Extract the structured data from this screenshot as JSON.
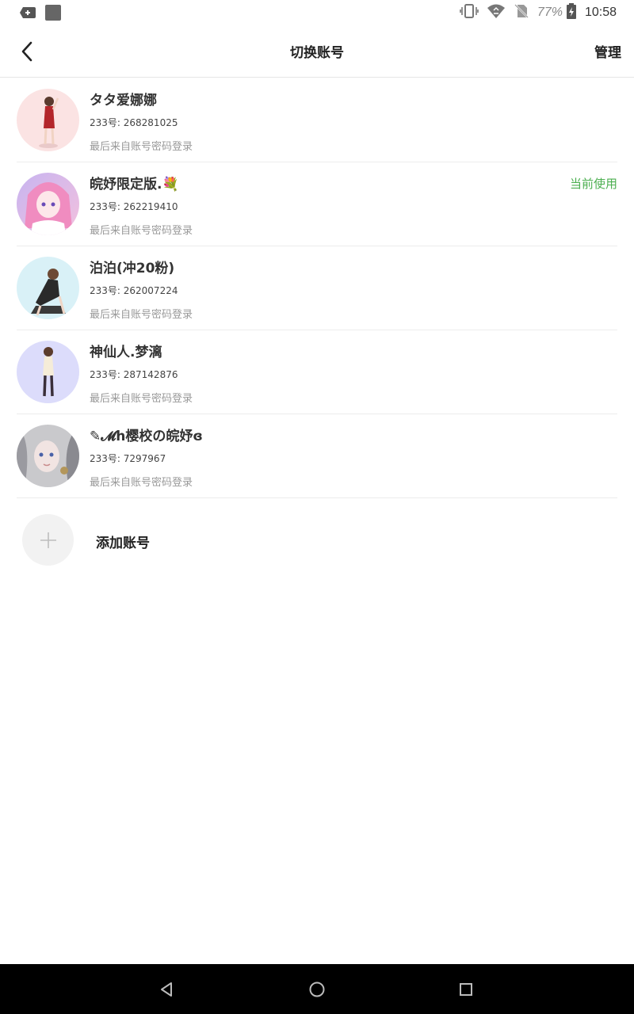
{
  "status_bar": {
    "left_icons": [
      "add-notification-icon",
      "square-app-icon"
    ],
    "right_icons": [
      "vibrate-icon",
      "wifi-icon",
      "no-sim-icon",
      "battery-icon"
    ],
    "battery": "77%",
    "time": "10:58"
  },
  "header": {
    "title": "切换账号",
    "manage_label": "管理",
    "back_icon": "back-arrow-icon"
  },
  "accounts": [
    {
      "nickname": "タタ爱娜娜",
      "uid": "233号: 268281025",
      "login_method": "最后来自账号密码登录",
      "current": "",
      "avatar_bg": "#fbe3e3"
    },
    {
      "nickname": "皖妤限定版.💐",
      "uid": "233号: 262219410",
      "login_method": "最后来自账号密码登录",
      "current": "当前使用",
      "avatar_bg": "#d7c8f2"
    },
    {
      "nickname": "泊泊(冲20粉)",
      "uid": "233号: 262007224",
      "login_method": "最后来自账号密码登录",
      "current": "",
      "avatar_bg": "#d9f1f7"
    },
    {
      "nickname": "神仙人.梦漓",
      "uid": "233号: 287142876",
      "login_method": "最后来自账号密码登录",
      "current": "",
      "avatar_bg": "#dcdcfb"
    },
    {
      "nickname": "✎𝓜h樱校の皖妤ɞ",
      "uid": "233号: 7297967",
      "login_method": "最后来自账号密码登录",
      "current": "",
      "avatar_bg": "#c9c9cc"
    }
  ],
  "add_account": {
    "label": "添加账号",
    "icon": "plus-icon"
  },
  "nav_bar": {
    "buttons": [
      "nav-back-icon",
      "nav-home-icon",
      "nav-recents-icon"
    ]
  },
  "colors": {
    "accent_green": "#4caf50",
    "divider": "#ececec",
    "secondary_text": "#999999"
  }
}
